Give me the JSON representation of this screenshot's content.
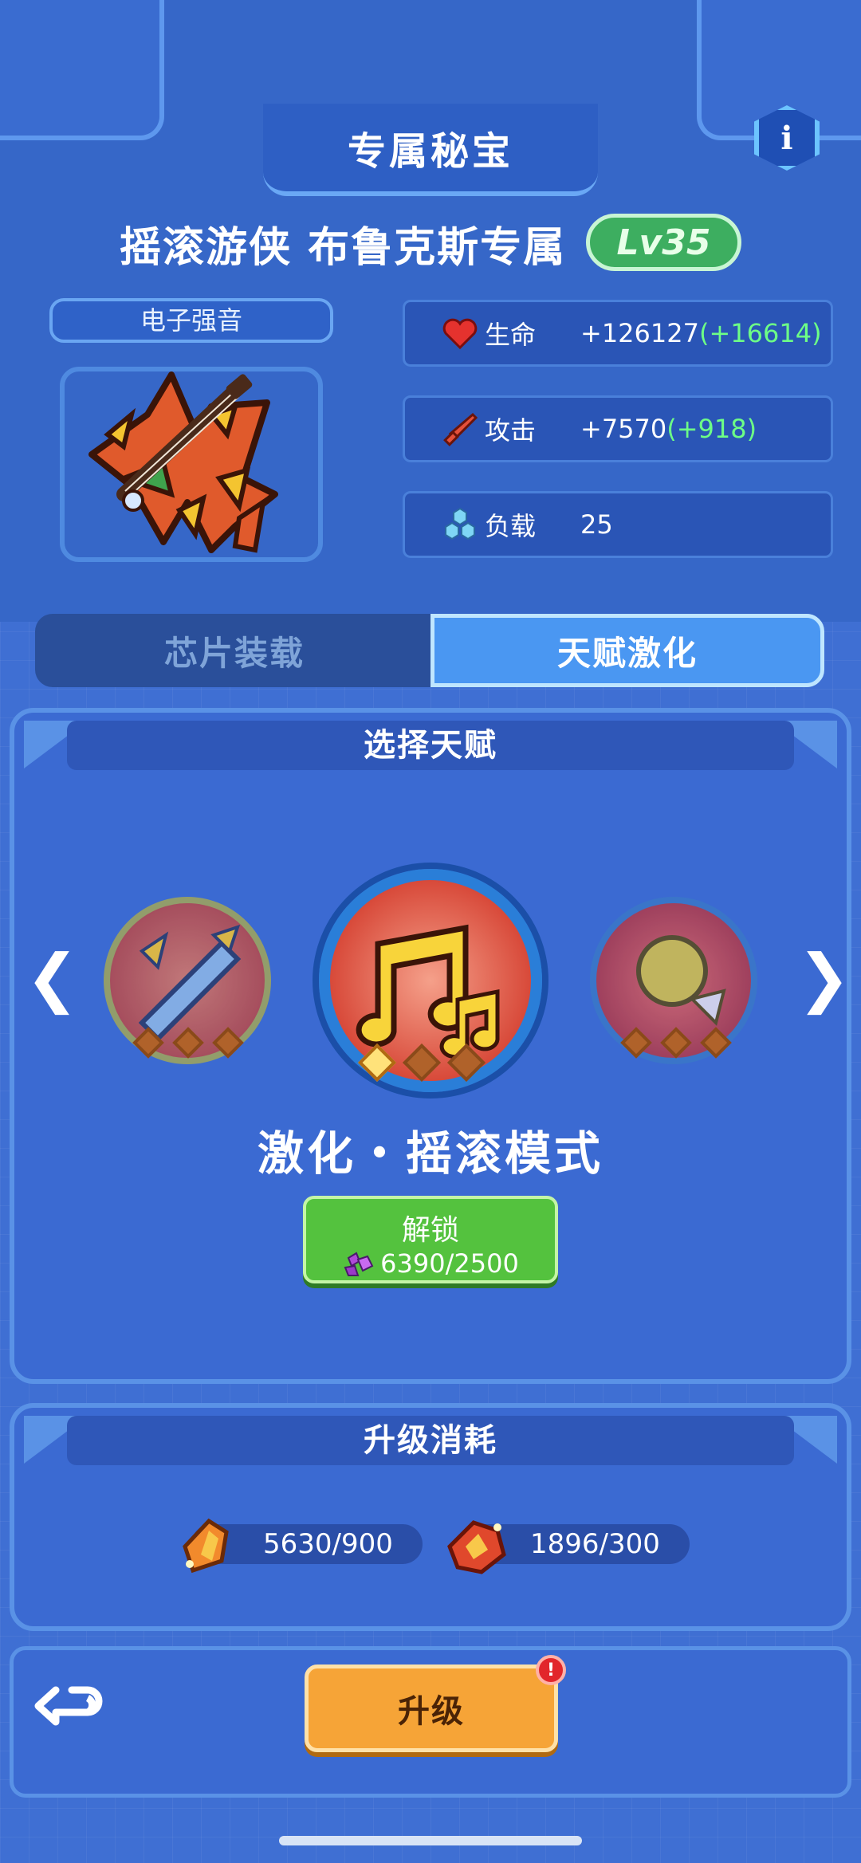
{
  "header": {
    "title": "专属秘宝",
    "info_icon": "i"
  },
  "item": {
    "name": "摇滚游侠 布鲁克斯专属",
    "level": "Lv35",
    "subtitle": "电子强音"
  },
  "stats": [
    {
      "icon": "heart-icon",
      "label": "生命",
      "value": "+126127",
      "bonus": "(+16614)"
    },
    {
      "icon": "sword-icon",
      "label": "攻击",
      "value": "+7570",
      "bonus": "(+918)"
    },
    {
      "icon": "hexagon-cluster-icon",
      "label": "负载",
      "value": "25",
      "bonus": ""
    }
  ],
  "tabs": [
    {
      "label": "芯片装载",
      "active": false
    },
    {
      "label": "天赋激化",
      "active": true
    }
  ],
  "talent_panel": {
    "header": "选择天赋",
    "selected_name": "激化・摇滚模式",
    "unlock_label": "解锁",
    "unlock_cost": "6390/2500",
    "talents": [
      {
        "icon": "sword-talent-icon",
        "stars_on": 0,
        "stars_total": 3
      },
      {
        "icon": "music-note-talent-icon",
        "stars_on": 1,
        "stars_total": 3
      },
      {
        "icon": "golden-orb-talent-icon",
        "stars_on": 0,
        "stars_total": 3
      }
    ]
  },
  "upgrade_panel": {
    "header": "升级消耗",
    "costs": [
      {
        "icon": "orange-crystal-icon",
        "value": "5630/900"
      },
      {
        "icon": "red-crystal-icon",
        "value": "1896/300"
      }
    ]
  },
  "bottom": {
    "upgrade_label": "升级",
    "alert": "!"
  },
  "colors": {
    "bonus_green": "#6dff86",
    "unlock_green": "#54c23e",
    "upgrade_orange": "#f6a437"
  }
}
